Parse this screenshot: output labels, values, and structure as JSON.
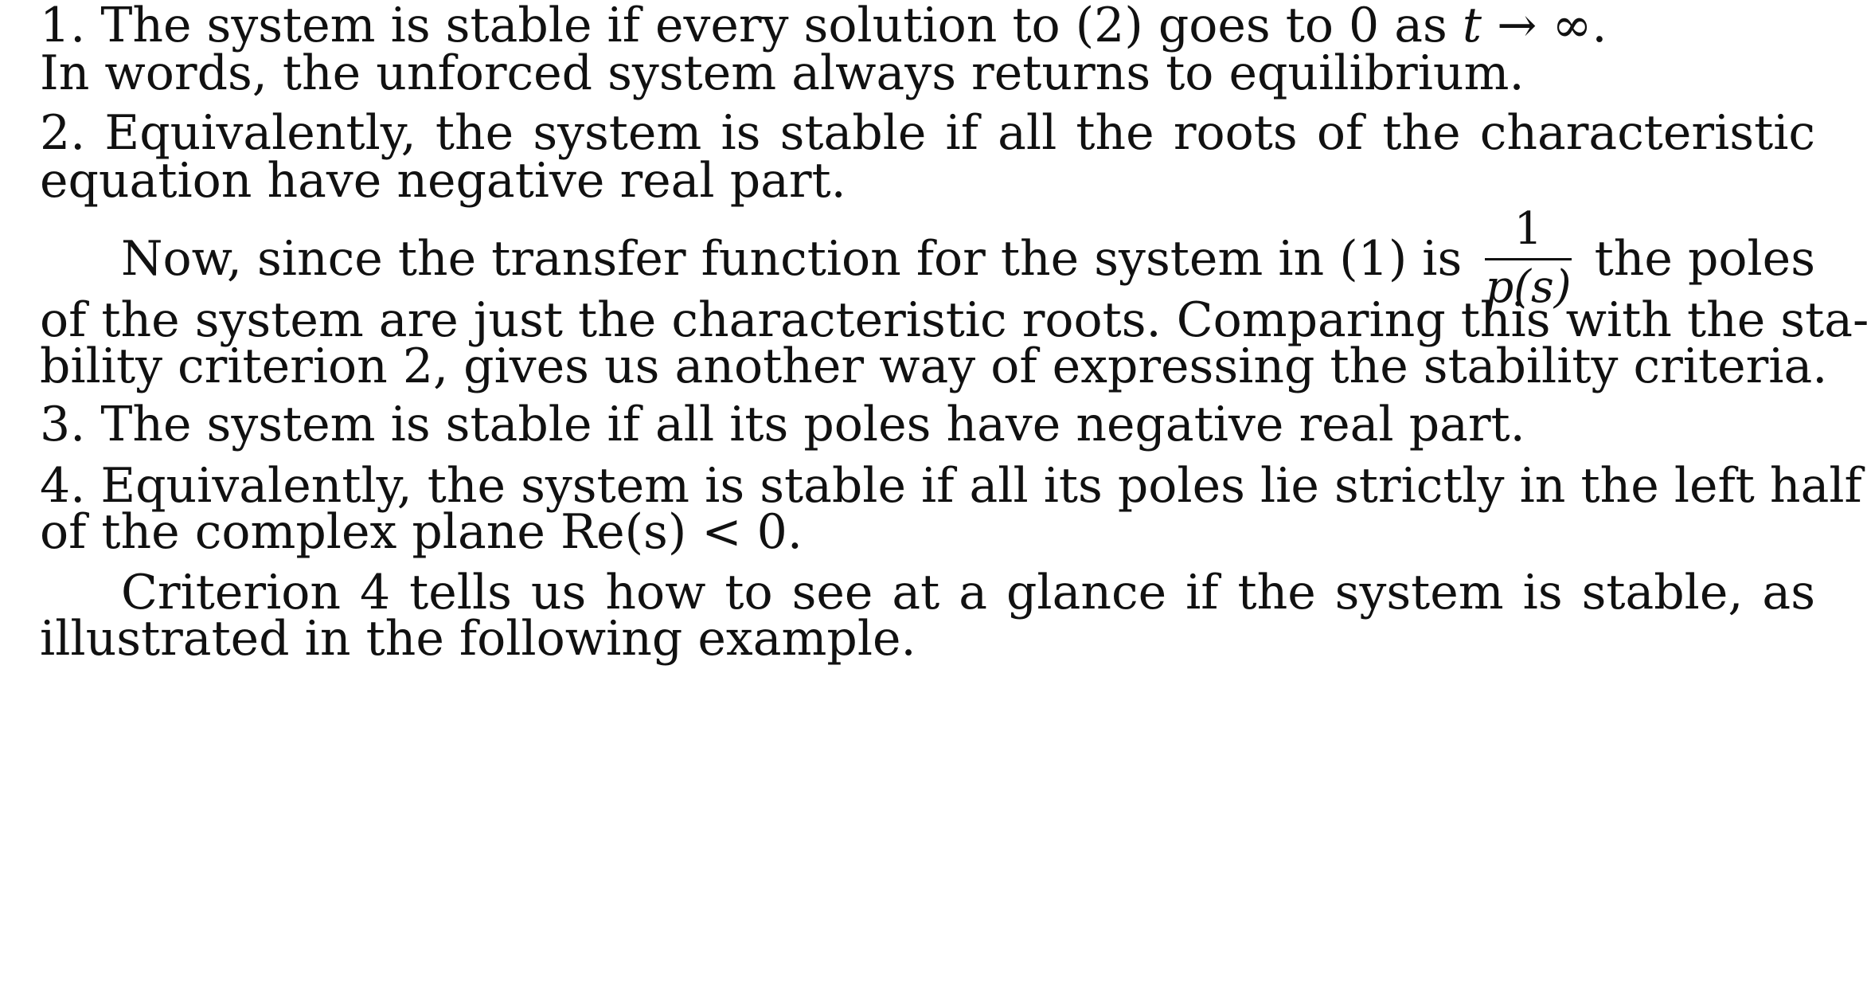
{
  "item1": {
    "line1_prefix": "1. The system is stable if every solution to (2) goes to 0 as ",
    "line1_var": "t",
    "line1_suffix": " → ∞.",
    "line2": "In words, the unforced system always returns to equilibrium."
  },
  "item2": {
    "line1": "2. Equivalently, the system is stable if all the roots of the characteristic",
    "line2": "equation have negative real part."
  },
  "paragraph1": {
    "line1_prefix": "Now, since the transfer function for the system in (1) is",
    "frac_num": "1",
    "frac_den": "p(s)",
    "line1_suffix": "the poles",
    "line2": "of the system are just the characteristic roots. Comparing this with the sta-",
    "line3": "bility criterion 2, gives us another way of expressing the stability criteria."
  },
  "item3": {
    "line1": "3. The system is stable if all its poles have negative real part."
  },
  "item4": {
    "line1": "4. Equivalently, the system is stable if all its poles lie strictly in the left half",
    "line2_prefix": "of the complex plane ",
    "line2_math": "Re(s) < 0."
  },
  "paragraph2": {
    "line1": "Criterion 4 tells us how to see at a glance if the system is stable, as",
    "line2": "illustrated in the following example."
  }
}
